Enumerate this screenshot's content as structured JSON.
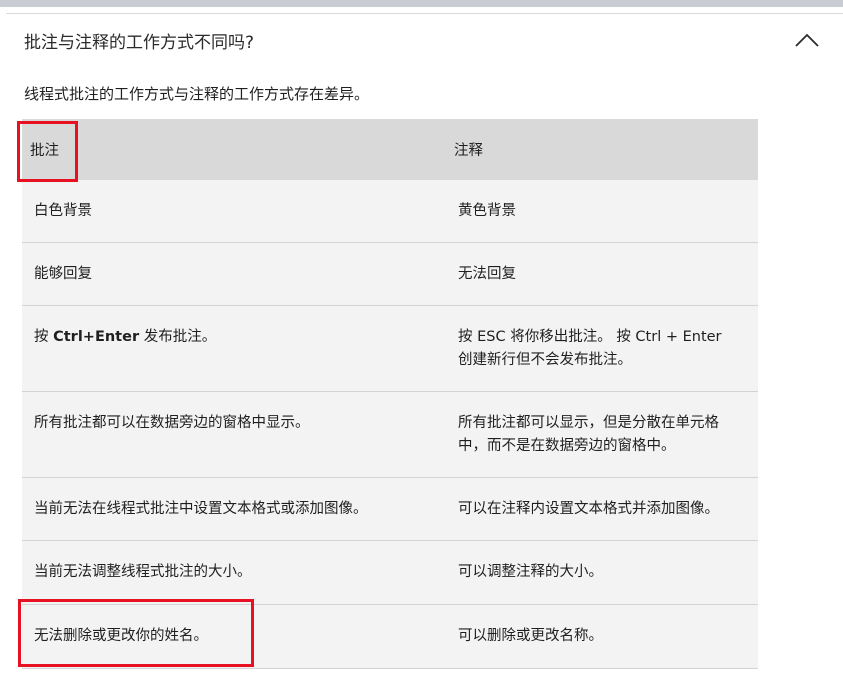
{
  "accordion": {
    "title": "批注与注释的工作方式不同吗?",
    "expanded": true,
    "toggle_icon": "chevron-up-icon"
  },
  "intro": "线程式批注的工作方式与注释的工作方式存在差异。",
  "table": {
    "headers": [
      "批注",
      "注释"
    ],
    "rows": [
      {
        "comments": "白色背景",
        "notes": "黄色背景"
      },
      {
        "comments": "能够回复",
        "notes": "无法回复"
      },
      {
        "comments_prefix": "按 ",
        "comments_key": "Ctrl+Enter",
        "comments_suffix": " 发布批注。",
        "notes": "按 ESC 将你移出批注。 按 Ctrl + Enter 创建新行但不会发布批注。"
      },
      {
        "comments": "所有批注都可以在数据旁边的窗格中显示。",
        "notes": "所有批注都可以显示，但是分散在单元格中，而不是在数据旁边的窗格中。"
      },
      {
        "comments": "当前无法在线程式批注中设置文本格式或添加图像。",
        "notes": "可以在注释内设置文本格式并添加图像。"
      },
      {
        "comments": "当前无法调整线程式批注的大小。",
        "notes": "可以调整注释的大小。"
      },
      {
        "comments": "无法删除或更改你的姓名。",
        "notes": "可以删除或更改名称。"
      }
    ]
  },
  "colors": {
    "header_bg": "#d9d9d9",
    "row_bg": "#f3f3f3",
    "highlight": "#e81123"
  }
}
